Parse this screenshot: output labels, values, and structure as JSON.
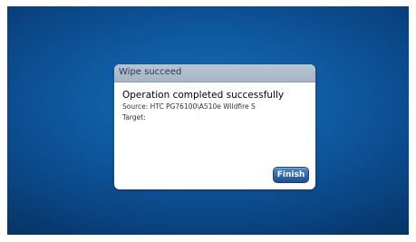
{
  "dialog": {
    "title": "Wipe succeed",
    "message": "Operation completed successfully",
    "source_line": "Source: HTC PG76100\\A510e Wildfire S",
    "target_line": "Target:",
    "finish_label": "Finish"
  },
  "colors": {
    "background_blue": "#0f5aa1",
    "title_bar": "#b0bcc9",
    "button_blue": "#2f63a8"
  }
}
